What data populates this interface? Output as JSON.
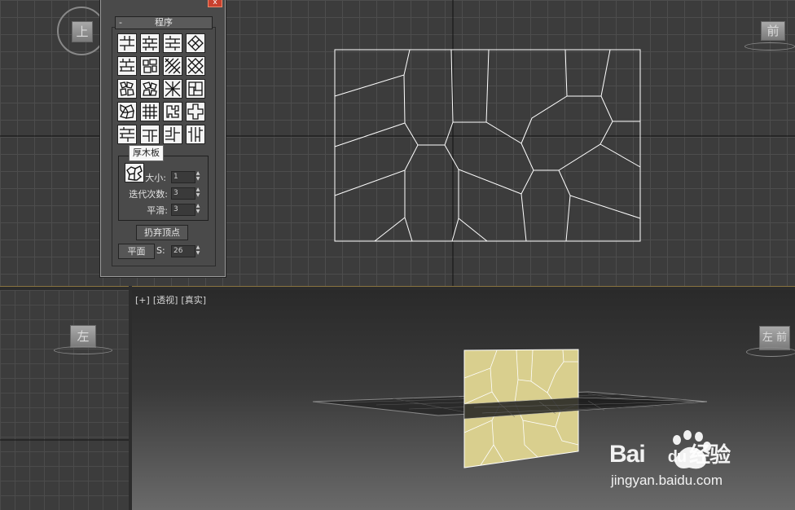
{
  "dialog": {
    "title": "",
    "close_glyph": "x",
    "rollout_title": "程序",
    "rollout_toggle": "-",
    "tooltip": "厚木板",
    "group_label": "",
    "fields": [
      {
        "label": "大小:",
        "value": "1"
      },
      {
        "label": "迭代次数:",
        "value": "3"
      },
      {
        "label": "平滑:",
        "value": "3"
      }
    ],
    "discard_vertices_label": "扔弃顶点",
    "plane_label": "平面",
    "seed_label": "S:",
    "seed_value": "26",
    "pattern_buttons": [
      "brick-grid-icon",
      "brick-stack-icon",
      "running-bond-icon",
      "diamond-tile-icon",
      "brick-offset-icon",
      "irregular-block-icon",
      "diagonal-hatch-icon",
      "diamond-grid-icon",
      "cobblestone-icon",
      "flagstone-icon",
      "lattice-icon",
      "interlock-icon",
      "crazy-paving-icon",
      "square-grid-icon",
      "puzzle-icon",
      "cross-tile-icon",
      "plank-h-icon",
      "plank-mixed-icon",
      "parquet-icon",
      "plank-v-icon"
    ]
  },
  "viewports": {
    "top_cube_label": "上",
    "front_cube_label": "前",
    "left_cube_label": "左",
    "persp_cube_label": "左 前",
    "persp_label": {
      "plus": "[+]",
      "mode": "[透视]",
      "shading": "[真实]"
    }
  },
  "watermark": {
    "brand_a": "Bai",
    "brand_b": "du",
    "brand_c": "经验",
    "url": "jingyan.baidu.com"
  },
  "colors": {
    "accent": "#c8402e",
    "plank_fill": "#d9cf8e",
    "wire": "#ffffff"
  }
}
